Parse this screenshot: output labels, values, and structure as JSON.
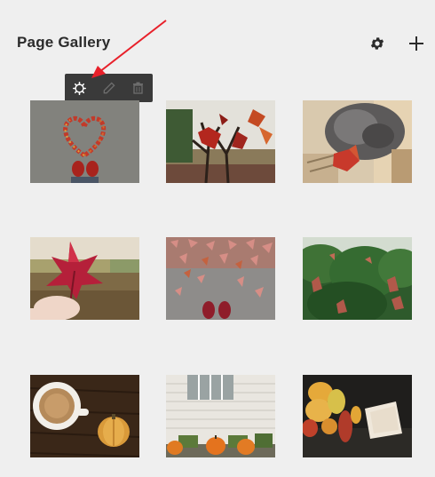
{
  "header": {
    "title": "Page Gallery",
    "settings_icon": "gear-icon",
    "add_icon": "plus-icon"
  },
  "toolbar": {
    "buttons": [
      {
        "name": "item-settings",
        "icon": "gear-outline-icon"
      },
      {
        "name": "edit",
        "icon": "pencil-icon"
      },
      {
        "name": "delete",
        "icon": "trash-icon"
      }
    ]
  },
  "gallery": {
    "images": [
      {
        "name": "leaf-heart-boots",
        "selected": true
      },
      {
        "name": "red-leaves-tree"
      },
      {
        "name": "cat-with-leaf"
      },
      {
        "name": "hand-holding-red-leaf"
      },
      {
        "name": "leaves-on-pavement-boots"
      },
      {
        "name": "evergreen-tree-red-leaves"
      },
      {
        "name": "coffee-and-gourd"
      },
      {
        "name": "pumpkins-by-white-house"
      },
      {
        "name": "gourds-and-card"
      }
    ]
  },
  "colors": {
    "background": "#efefef",
    "toolbar": "#3a3a3a",
    "annotation_arrow": "#e8202a"
  }
}
